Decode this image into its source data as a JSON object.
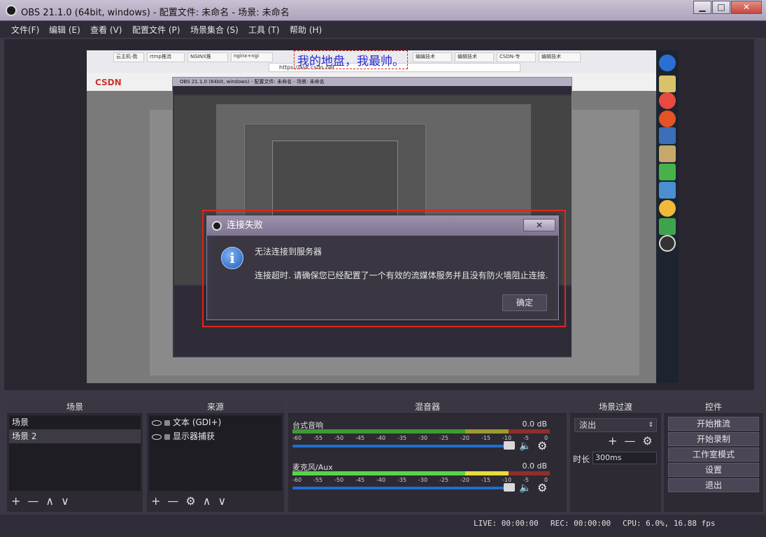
{
  "window": {
    "title": "OBS 21.1.0 (64bit, windows) - 配置文件: 未命名 - 场景: 未命名",
    "controls": {
      "minimize": "▁",
      "maximize": "□",
      "close": "✕"
    }
  },
  "menu": [
    {
      "label": "文件(F)"
    },
    {
      "label": "编辑 (E)"
    },
    {
      "label": "查看 (V)"
    },
    {
      "label": "配置文件 (P)"
    },
    {
      "label": "场景集合 (S)"
    },
    {
      "label": "工具 (T)"
    },
    {
      "label": "帮助 (H)"
    }
  ],
  "preview": {
    "overlay_text": "我的地盘，我最帅。",
    "browser_url": "https://ask.csdn.net",
    "browser_tabs": [
      "云主机-我",
      "rtmp推流",
      "NGINX推",
      "nginx+ngi",
      "",
      "编编技术",
      "编辑技术",
      "CSDN-专",
      "编辑技术"
    ],
    "csdn_logo": "CSDN",
    "nested_title": "OBS 21.1.0 (64bit, windows) - 配置文件: 未命名 - 场景: 未命名"
  },
  "dialog": {
    "title": "连接失败",
    "close_label": "✕",
    "icon": "info-icon",
    "heading": "无法连接到服务器",
    "message": "连接超时. 请确保您已经配置了一个有效的流媒体服务并且没有防火墙阻止连接.",
    "ok_label": "确定"
  },
  "docks": {
    "scenes": {
      "header": "场景",
      "items": [
        {
          "label": "场景",
          "selected": true
        },
        {
          "label": "场景 2",
          "selected": false
        }
      ]
    },
    "sources": {
      "header": "来源",
      "items": [
        {
          "label": "文本 (GDI+)"
        },
        {
          "label": "显示器捕获"
        }
      ]
    },
    "mixer": {
      "header": "混音器",
      "channels": [
        {
          "name": "台式音响",
          "db": "0.0 dB",
          "level": 0.0
        },
        {
          "name": "麦克风/Aux",
          "db": "0.0 dB",
          "level": 0.95
        }
      ],
      "ticks": [
        "-60",
        "-55",
        "-50",
        "-45",
        "-40",
        "-35",
        "-30",
        "-25",
        "-20",
        "-15",
        "-10",
        "-5",
        "0"
      ]
    },
    "transitions": {
      "header": "场景过渡",
      "selected": "淡出",
      "duration_label": "时长",
      "duration_value": "300ms"
    },
    "controls": {
      "header": "控件",
      "buttons": [
        "开始推流",
        "开始录制",
        "工作室模式",
        "设置",
        "退出"
      ]
    }
  },
  "tool_glyphs": {
    "add": "+",
    "remove": "—",
    "up": "∧",
    "down": "∨",
    "gear": "⚙"
  },
  "status": {
    "live": "LIVE: 00:00:00",
    "rec": "REC: 00:00:00",
    "cpu": "CPU: 6.0%, 16.88 fps"
  },
  "colors": {
    "accent_red": "#e0261e",
    "slider_blue": "#1d6fd1"
  }
}
